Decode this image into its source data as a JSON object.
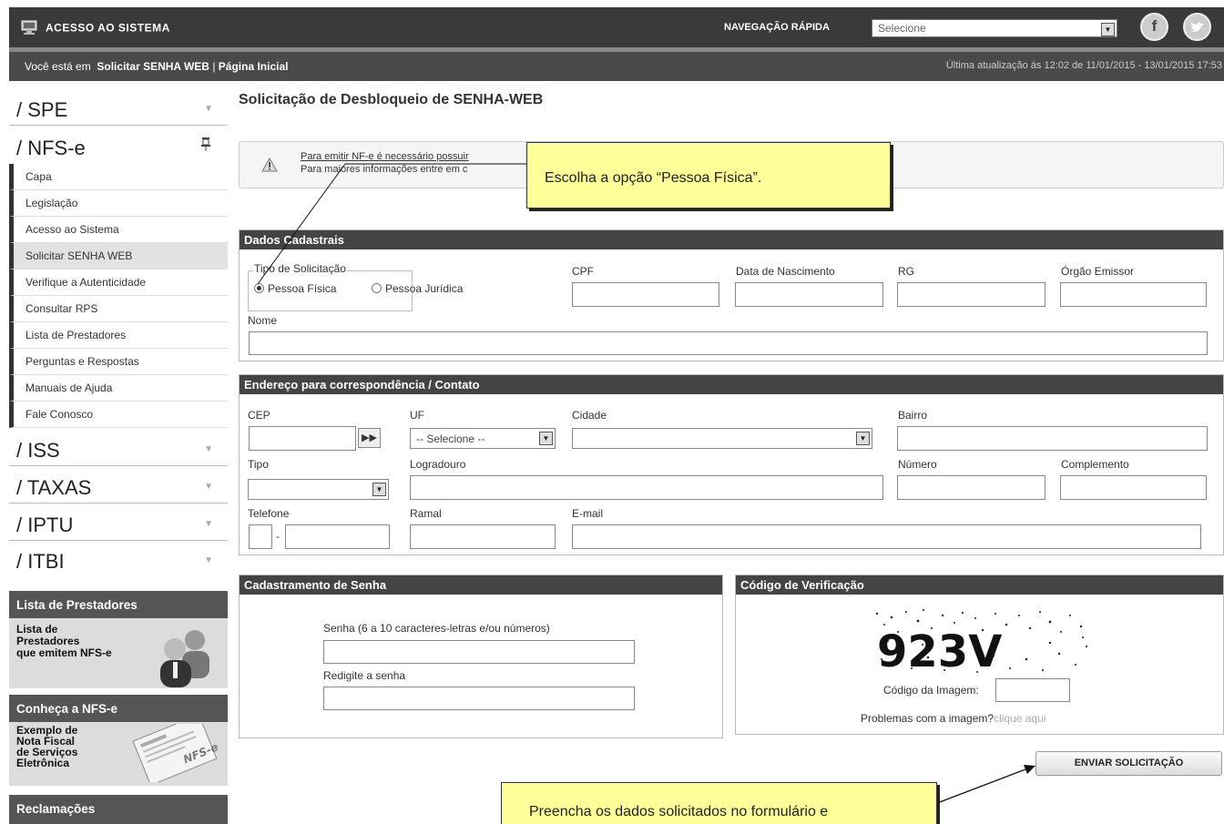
{
  "header": {
    "system_title": "ACESSO AO SISTEMA",
    "quick_nav_label": "NAVEGAÇÃO RÁPIDA",
    "quick_nav_value": "Selecione",
    "social": [
      "facebook-icon",
      "twitter-icon"
    ]
  },
  "breadcrumb": {
    "prefix": "Você está em",
    "current": "Solicitar SENHA WEB",
    "separator": "|",
    "home": "Página Inicial",
    "last_update": "Última atualização ás 12:02 de 11/01/2015 - 13/01/2015 17:53"
  },
  "sidebar": {
    "sections": [
      {
        "label": "/ SPE"
      },
      {
        "label": "/ NFS-e"
      },
      {
        "label": "/ ISS"
      },
      {
        "label": "/ TAXAS"
      },
      {
        "label": "/ IPTU"
      },
      {
        "label": "/ ITBI"
      }
    ],
    "items": [
      {
        "label": "Capa"
      },
      {
        "label": "Legislação"
      },
      {
        "label": "Acesso ao Sistema"
      },
      {
        "label": "Solicitar SENHA WEB"
      },
      {
        "label": "Verifique a Autenticidade"
      },
      {
        "label": "Consultar RPS"
      },
      {
        "label": "Lista de Prestadores"
      },
      {
        "label": "Perguntas e Respostas"
      },
      {
        "label": "Manuais de Ajuda"
      },
      {
        "label": "Fale Conosco"
      }
    ],
    "promos": [
      {
        "title": "Lista de Prestadores",
        "lines": [
          "Lista de",
          "Prestadores",
          "que emitem NFS-e"
        ]
      },
      {
        "title": "Conheça a NFS-e",
        "lines": [
          "Exemplo de",
          "Nota Fiscal",
          "de Serviços",
          "Eletrônica"
        ]
      },
      {
        "title": "Reclamações"
      }
    ]
  },
  "main": {
    "title": "Solicitação de Desbloqueio de SENHA-WEB",
    "notice_line1_link": "Para emitir NF-e é necessário possuir",
    "notice_line2": "Para maiores informações entre em c",
    "callout_top": "Escolha a opção “Pessoa Física”.",
    "callout_bottom": "Preencha os dados solicitados no formulário e"
  },
  "dados": {
    "heading": "Dados Cadastrais",
    "tipo_label": "Tipo de Solicitação",
    "opt_pf": "Pessoa Física",
    "opt_pj": "Pessoa Jurídica",
    "cpf": "CPF",
    "nascimento": "Data de Nascimento",
    "rg": "RG",
    "orgao": "Órgão Emissor",
    "nome": "Nome"
  },
  "endereco": {
    "heading": "Endereço para correspondência / Contato",
    "cep": "CEP",
    "uf": "UF",
    "uf_value": "-- Selecione --",
    "cidade": "Cidade",
    "bairro": "Bairro",
    "tipo": "Tipo",
    "logradouro": "Logradouro",
    "numero": "Número",
    "complemento": "Complemento",
    "telefone": "Telefone",
    "ramal": "Ramal",
    "email": "E-mail"
  },
  "senha": {
    "heading": "Cadastramento de Senha",
    "senha_label": "Senha (6 a 10 caracteres-letras e/ou números)",
    "redigite_label": "Redigite a senha"
  },
  "captcha": {
    "heading": "Código de Verificação",
    "text": "923V",
    "code_label": "Código da Imagem:",
    "problems": "Problemas com a imagem?",
    "problems_link": "clique aqui"
  },
  "actions": {
    "send": "ENVIAR SOLICITAÇÃO"
  }
}
